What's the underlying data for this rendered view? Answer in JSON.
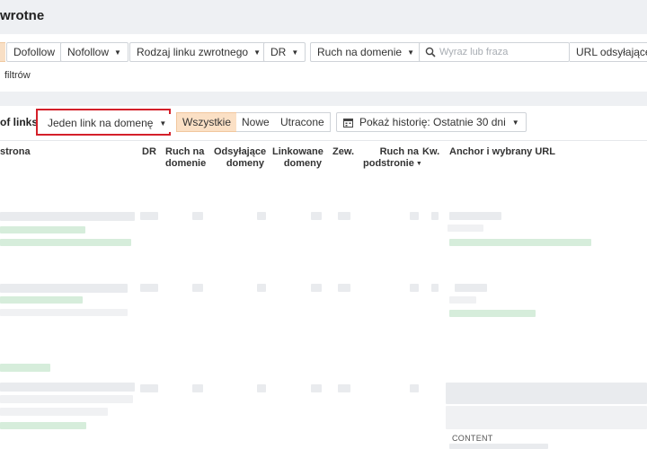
{
  "header": {
    "title": "wrotne"
  },
  "filters": {
    "buttons": [
      {
        "label": "Dofollow",
        "dropdown": false
      },
      {
        "label": "Nofollow",
        "dropdown": true
      },
      {
        "label": "Rodzaj linku zwrotnego",
        "dropdown": true
      },
      {
        "label": "DR",
        "dropdown": true
      },
      {
        "label": "Ruch na domenie",
        "dropdown": true
      }
    ],
    "search_placeholder": "Wyraz lub fraza",
    "url_dropdown": "URL odsyłające",
    "filters_link": "filtrów"
  },
  "controls": {
    "group_label": "of links",
    "grouping_dropdown": "Jeden link na domenę",
    "segments": [
      "Wszystkie",
      "Nowe",
      "Utracone"
    ],
    "active_segment": "Wszystkie",
    "history_dropdown": "Pokaż historię: Ostatnie 30 dni"
  },
  "table": {
    "columns": [
      {
        "line1": "strona",
        "line2": ""
      },
      {
        "line1": "DR",
        "line2": ""
      },
      {
        "line1": "Ruch na",
        "line2": "domenie"
      },
      {
        "line1": "Odsyłające",
        "line2": "domeny"
      },
      {
        "line1": "Linkowane",
        "line2": "domeny"
      },
      {
        "line1": "Zew.",
        "line2": ""
      },
      {
        "line1": "Ruch na",
        "line2": "podstronie"
      },
      {
        "line1": "Kw.",
        "line2": ""
      },
      {
        "line1": "Anchor i wybrany URL",
        "line2": ""
      }
    ],
    "content_tag": "CONTENT"
  },
  "colors": {
    "highlight_border": "#d4202a",
    "active_segment_bg": "#fbe0c5",
    "blurred_link_green": "#d6eddb"
  }
}
